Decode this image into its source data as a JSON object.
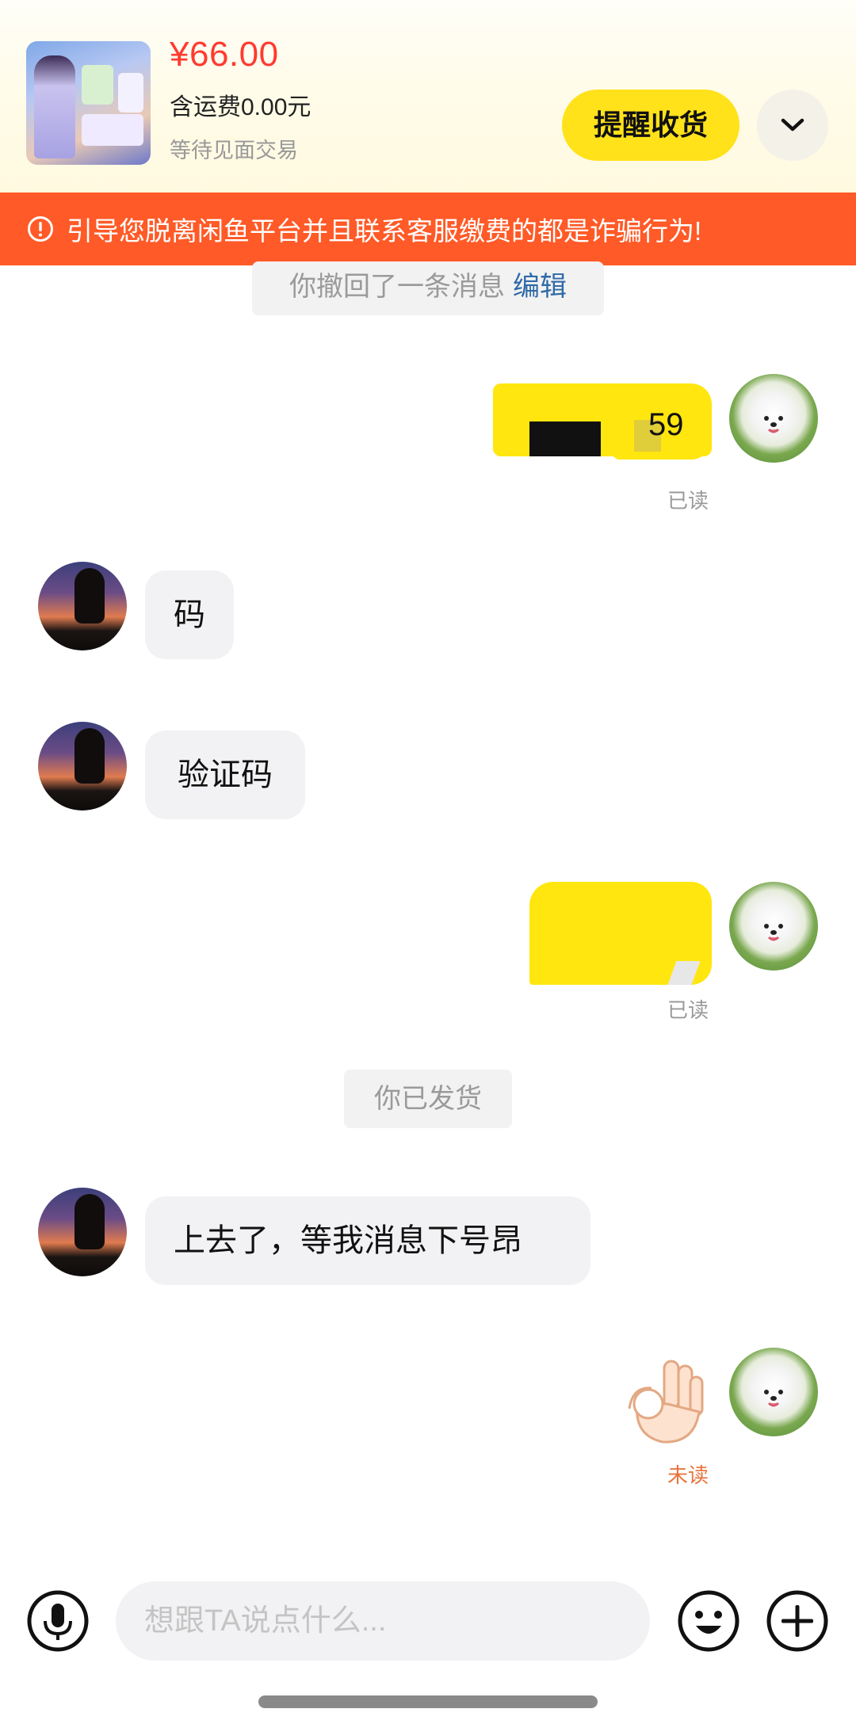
{
  "order": {
    "price": "¥66.00",
    "shipping": "含运费0.00元",
    "status": "等待见面交易",
    "remind_label": "提醒收货"
  },
  "warning": {
    "text": "引导您脱离闲鱼平台并且联系客服缴费的都是诈骗行为!",
    "color": "#ff5a27"
  },
  "chat": {
    "recall_text": "你撤回了一条消息",
    "recall_edit": "编辑",
    "msg1_visible_fragment": "59",
    "msg1_read": "已读",
    "msg2": "码",
    "msg3": "验证码",
    "msg4_read": "已读",
    "shipped_notice": "你已发货",
    "msg5": "上去了，等我消息下号昂",
    "msg6_emoji": "ok-hand-emoji",
    "msg6_status": "未读"
  },
  "composer": {
    "placeholder": "想跟TA说点什么..."
  },
  "colors": {
    "accent_yellow": "#ffe21a",
    "price_red": "#ff3b30",
    "unread_orange": "#e8743b",
    "link_blue": "#2f6aa8"
  }
}
